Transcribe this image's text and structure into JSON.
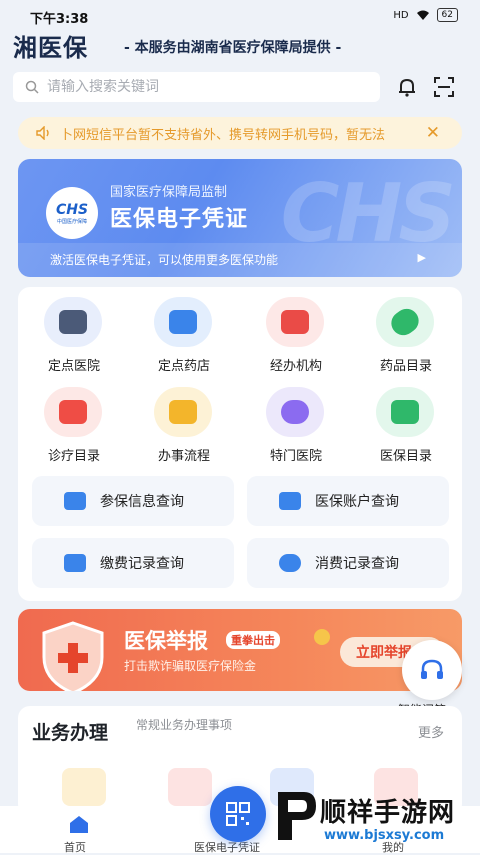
{
  "status_bar": {
    "time": "下午3:38",
    "signal": "HD",
    "battery": "62"
  },
  "header": {
    "logo": "湘医保",
    "subtitle": "- 本服务由湖南省医疗保障局提供 -"
  },
  "search": {
    "placeholder": "请输入搜索关键词"
  },
  "notice": {
    "text": "卜网短信平台暂不支持省外、携号转网手机号码，暂无法"
  },
  "hero": {
    "supervisor": "国家医疗保障局监制",
    "title": "医保电子凭证",
    "description": "激活医保电子凭证，可以使用更多医保功能",
    "badge_text": "CHS",
    "badge_sub": "中国医疗保障",
    "watermark": "CHS"
  },
  "grid": {
    "items": [
      {
        "label": "定点医院",
        "icon": "hospital-icon",
        "bg": "#e8eefc",
        "color": "#4b5a78"
      },
      {
        "label": "定点药店",
        "icon": "pharmacy-icon",
        "bg": "#e3eefd",
        "color": "#3a84ea"
      },
      {
        "label": "经办机构",
        "icon": "agency-icon",
        "bg": "#fde8e7",
        "color": "#ea4b47"
      },
      {
        "label": "药品目录",
        "icon": "medicine-icon",
        "bg": "#e3f7ec",
        "color": "#2fb86a"
      },
      {
        "label": "诊疗目录",
        "icon": "treatment-icon",
        "bg": "#fde8e6",
        "color": "#ef4d45"
      },
      {
        "label": "办事流程",
        "icon": "process-icon",
        "bg": "#fdf2d6",
        "color": "#f3b52b"
      },
      {
        "label": "特门医院",
        "icon": "special-clinic-icon",
        "bg": "#ece8fb",
        "color": "#8b6bf0"
      },
      {
        "label": "医保目录",
        "icon": "insurance-catalog-icon",
        "bg": "#e3f7ec",
        "color": "#2fb86a"
      }
    ],
    "queries": [
      {
        "label": "参保信息查询",
        "icon": "insured-info-icon",
        "color": "#3a84ea"
      },
      {
        "label": "医保账户查询",
        "icon": "account-icon",
        "color": "#3a84ea"
      },
      {
        "label": "缴费记录查询",
        "icon": "payment-icon",
        "color": "#3a84ea"
      },
      {
        "label": "消费记录查询",
        "icon": "consumption-icon",
        "color": "#3a84ea"
      }
    ]
  },
  "report": {
    "title": "医保举报",
    "tag": "重拳出击",
    "subtitle": "打击欺诈骗取医疗保险金",
    "button": "立即举报"
  },
  "assistant": {
    "label": "智能问答"
  },
  "business": {
    "title": "业务办理",
    "subtitle": "常规业务办理事项",
    "more": "更多"
  },
  "tabbar": {
    "home": "首页",
    "voucher": "医保电子凭证",
    "mine": "我的"
  },
  "watermark": {
    "brand": "顺祥手游网",
    "url": "www.bjsxsy.com"
  }
}
